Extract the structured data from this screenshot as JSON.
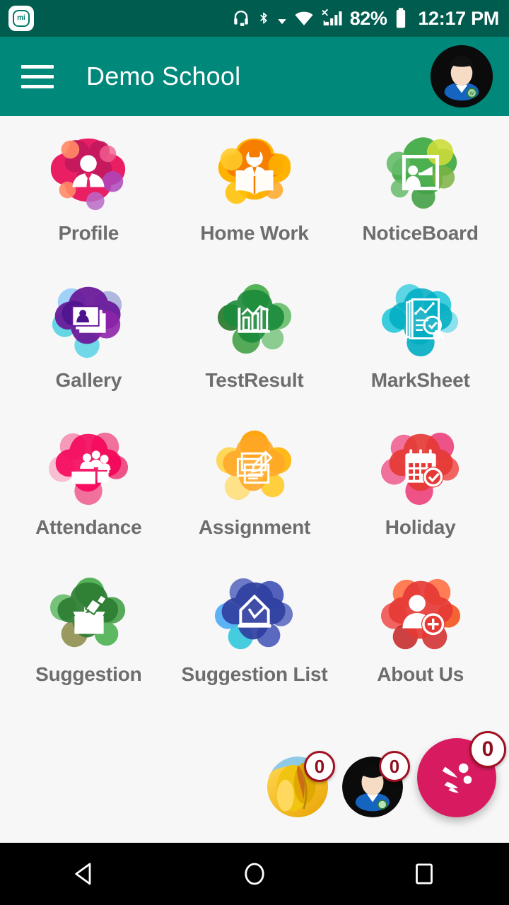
{
  "status_bar": {
    "brand_badge": "mi-logo-icon",
    "icons": [
      "headset-icon",
      "bluetooth-icon",
      "dropdown-caret-icon",
      "wifi-icon",
      "cellular-signal-icon"
    ],
    "battery_percent": "82%",
    "battery_icon": "battery-icon",
    "time": "12:17 PM"
  },
  "app_bar": {
    "menu_icon": "hamburger-menu-icon",
    "title": "Demo School",
    "avatar": "user-avatar"
  },
  "grid": {
    "items": [
      {
        "label": "Profile",
        "icon": "profile-icon",
        "blob": [
          "#e8336b",
          "#c2185b",
          "#f06292",
          "#ff8a65",
          "#ab47bc"
        ]
      },
      {
        "label": "Home Work",
        "icon": "home-work-icon",
        "blob": [
          "#f57c00",
          "#ff5722",
          "#ffb300",
          "#ffca28",
          "#ff9800"
        ]
      },
      {
        "label": "NoticeBoard",
        "icon": "notice-board-icon",
        "blob": [
          "#4caf50",
          "#8bc34a",
          "#cddc39",
          "#66bb6a",
          "#43a047"
        ]
      },
      {
        "label": "Gallery",
        "icon": "gallery-icon",
        "blob": [
          "#6a1b9a",
          "#7e57c2",
          "#90caf9",
          "#4dd0e1",
          "#8e24aa"
        ]
      },
      {
        "label": "TestResult",
        "icon": "test-result-icon",
        "blob": [
          "#1b8a3a",
          "#2e7d32",
          "#66bb6a",
          "#43a047",
          "#81c784"
        ]
      },
      {
        "label": "MarkSheet",
        "icon": "mark-sheet-icon",
        "blob": [
          "#26c6da",
          "#00acc1",
          "#4dd0e1",
          "#0097a7",
          "#80deea"
        ]
      },
      {
        "label": "Attendance",
        "icon": "attendance-icon",
        "blob": [
          "#ec407a",
          "#f50057",
          "#f48fb1",
          "#e91e63",
          "#f8bbd0"
        ]
      },
      {
        "label": "Assignment",
        "icon": "assignment-icon",
        "blob": [
          "#ffa000",
          "#ffb300",
          "#ffd54f",
          "#ffc107",
          "#ffe082"
        ]
      },
      {
        "label": "Holiday",
        "icon": "holiday-icon",
        "blob": [
          "#e53935",
          "#d32f2f",
          "#f06292",
          "#ec407a",
          "#ef5350"
        ]
      },
      {
        "label": "Suggestion",
        "icon": "suggestion-icon",
        "blob": [
          "#2e7d32",
          "#43a047",
          "#4caf50",
          "#66bb6a",
          "#7a7a2e"
        ]
      },
      {
        "label": "Suggestion List",
        "icon": "suggestion-list-icon",
        "blob": [
          "#303f9f",
          "#3f51b5",
          "#5c6bc0",
          "#42a5f5",
          "#26c6da"
        ]
      },
      {
        "label": "About Us",
        "icon": "about-us-icon",
        "blob": [
          "#e53935",
          "#f4511e",
          "#ff7043",
          "#c62828",
          "#ef5350"
        ]
      }
    ]
  },
  "fabs": [
    {
      "name": "flower-photo-fab",
      "badge": "0"
    },
    {
      "name": "profile-photo-fab",
      "badge": "0"
    },
    {
      "name": "share-fab",
      "badge": "0",
      "color": "#d81b60",
      "icon": "share-dots-icon"
    }
  ],
  "nav_bar": {
    "back": "back-triangle-icon",
    "home": "home-circle-icon",
    "recents": "recents-square-icon"
  },
  "colors": {
    "status_bar": "#005c4f",
    "app_bar": "#00897b",
    "page_bg": "#f7f7f7",
    "label": "#6d6d6d",
    "fab_accent": "#d81b60",
    "nav_bar": "#000000"
  }
}
